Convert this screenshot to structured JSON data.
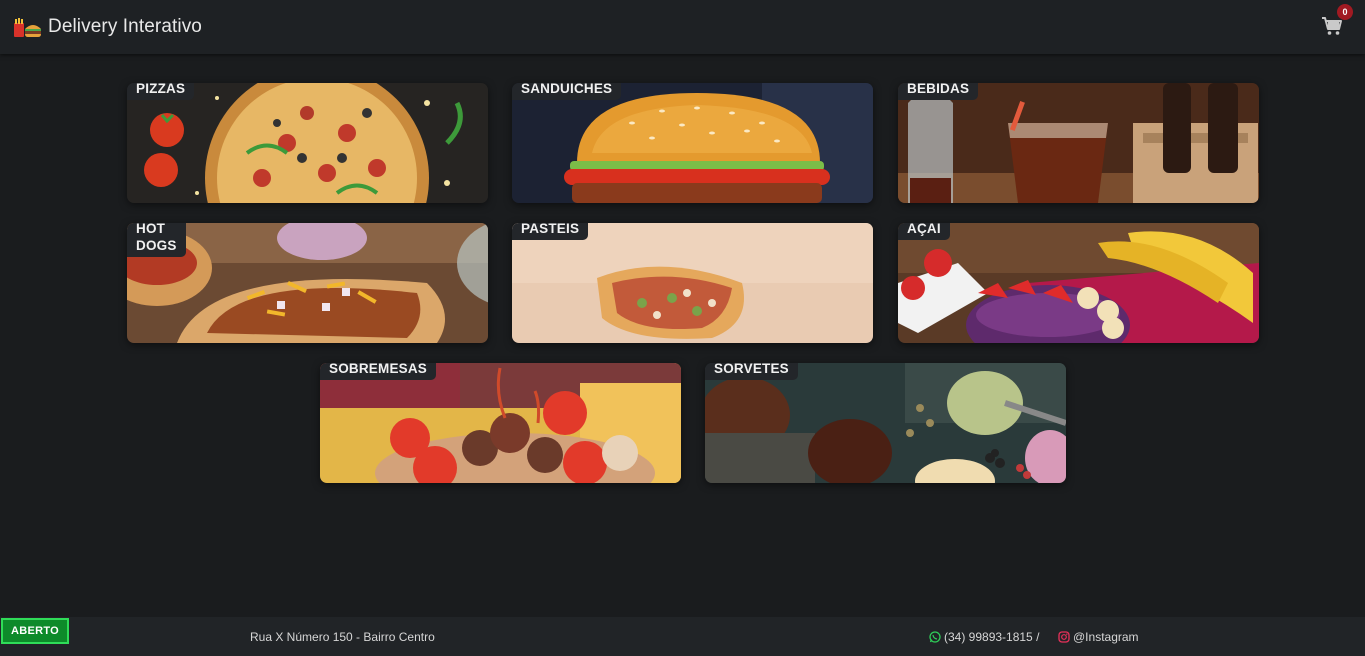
{
  "header": {
    "title": "Delivery Interativo",
    "logo_icon": "food-logo-icon",
    "cart_icon": "cart-icon",
    "cart_count": "0"
  },
  "categories": [
    {
      "label": "PIZZAS"
    },
    {
      "label": "SANDUICHES"
    },
    {
      "label": "BEBIDAS"
    },
    {
      "label": "HOT DOGS"
    },
    {
      "label": "PASTÉIS"
    },
    {
      "label": "AÇAÍ"
    },
    {
      "label": "SOBREMESAS"
    },
    {
      "label": "SORVETES"
    }
  ],
  "footer": {
    "status": "ABERTO",
    "address": "Rua X Número 150 - Bairro Centro",
    "phone": "(34) 99893-1815 /",
    "instagram": "@Instagram",
    "phone_icon": "whatsapp-icon",
    "instagram_icon": "instagram-icon"
  },
  "colors": {
    "background": "#1a1c1e",
    "header": "#1e2124",
    "status_open": "#0d8a2a",
    "badge": "#a11a22"
  }
}
